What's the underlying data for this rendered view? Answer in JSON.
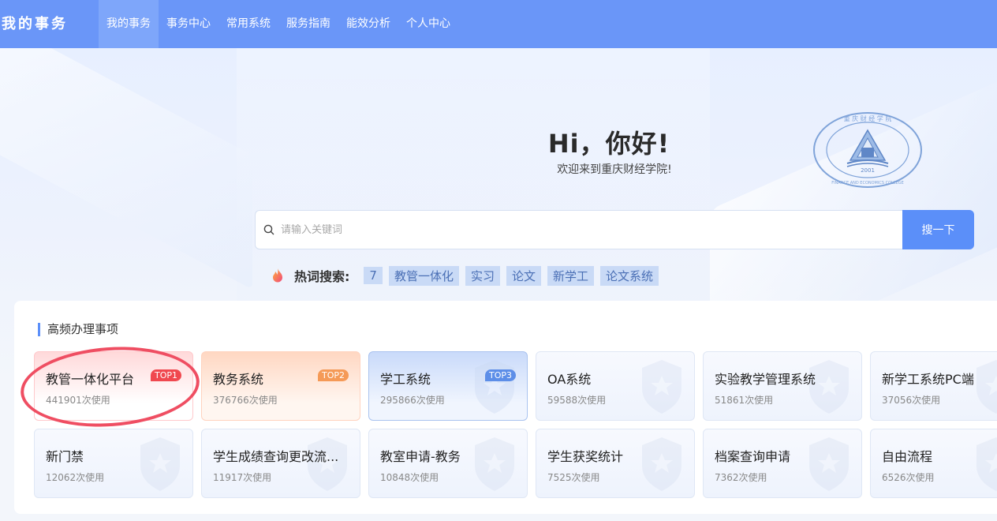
{
  "header": {
    "brand": "我的事务",
    "nav": [
      "我的事务",
      "事务中心",
      "常用系统",
      "服务指南",
      "能效分析",
      "个人中心"
    ],
    "active_index": 0,
    "accent_color": "#6a96f8"
  },
  "hero": {
    "greeting": "Hi，你好!",
    "welcome": "欢迎来到重庆财经学院!",
    "seal_icon": "college-seal-logo",
    "seal_lettering": [
      "重庆财经学院",
      "CHONGQING FINANCE AND ECONOMICS COLLEGE",
      "2001"
    ]
  },
  "search": {
    "placeholder": "请输入关键词",
    "value": "",
    "button_label": "搜一下",
    "icon": "search-icon"
  },
  "hot": {
    "label": "热词搜索:",
    "icon": "flame-icon",
    "tags": [
      "7",
      "教管一体化",
      "实习",
      "论文",
      "新学工",
      "论文系统"
    ]
  },
  "panel": {
    "title": "高频办理事项",
    "cards": [
      {
        "name": "教管一体化平台",
        "usage": "441901次使用",
        "badge": "TOP1"
      },
      {
        "name": "教务系统",
        "usage": "376766次使用",
        "badge": "TOP2"
      },
      {
        "name": "学工系统",
        "usage": "295866次使用",
        "badge": "TOP3"
      },
      {
        "name": "OA系统",
        "usage": "59588次使用",
        "badge": ""
      },
      {
        "name": "实验教学管理系统",
        "usage": "51861次使用",
        "badge": ""
      },
      {
        "name": "新学工系统PC端",
        "usage": "37056次使用",
        "badge": ""
      },
      {
        "name": "新门禁",
        "usage": "12062次使用",
        "badge": ""
      },
      {
        "name": "学生成绩查询更改流...",
        "usage": "11917次使用",
        "badge": ""
      },
      {
        "name": "教室申请-教务",
        "usage": "10848次使用",
        "badge": ""
      },
      {
        "name": "学生获奖统计",
        "usage": "7525次使用",
        "badge": ""
      },
      {
        "name": "档案查询申请",
        "usage": "7362次使用",
        "badge": ""
      },
      {
        "name": "自由流程",
        "usage": "6526次使用",
        "badge": ""
      }
    ]
  },
  "annotation": {
    "highlight_color": "#ef4e62",
    "highlighted_card_index": 0
  }
}
